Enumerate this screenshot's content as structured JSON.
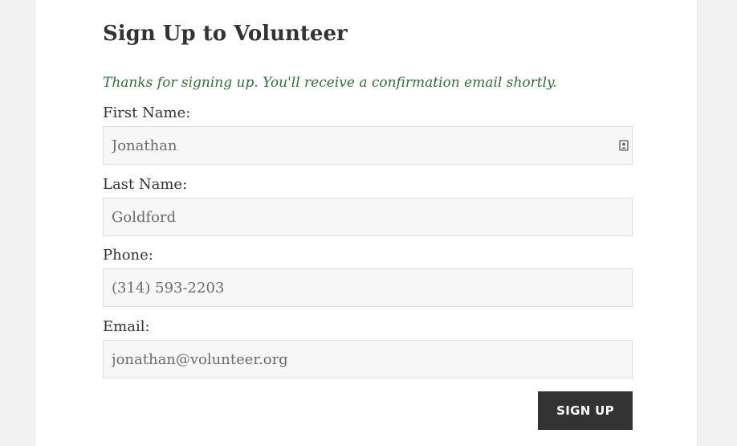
{
  "form": {
    "title": "Sign Up to Volunteer",
    "confirmation_message": "Thanks for signing up. You'll receive a confirmation email shortly.",
    "fields": [
      {
        "label": "First Name:",
        "value": "Jonathan"
      },
      {
        "label": "Last Name:",
        "value": "Goldford"
      },
      {
        "label": "Phone:",
        "value": "(314) 593-2203"
      },
      {
        "label": "Email:",
        "value": "jonathan@volunteer.org"
      }
    ],
    "submit_label": "SIGN UP"
  },
  "colors": {
    "confirmation_text": "#2e6f34",
    "button_background": "#333333",
    "input_background": "#f7f7f7"
  },
  "icons": {
    "first_name_autofill": "contact-card-icon"
  }
}
